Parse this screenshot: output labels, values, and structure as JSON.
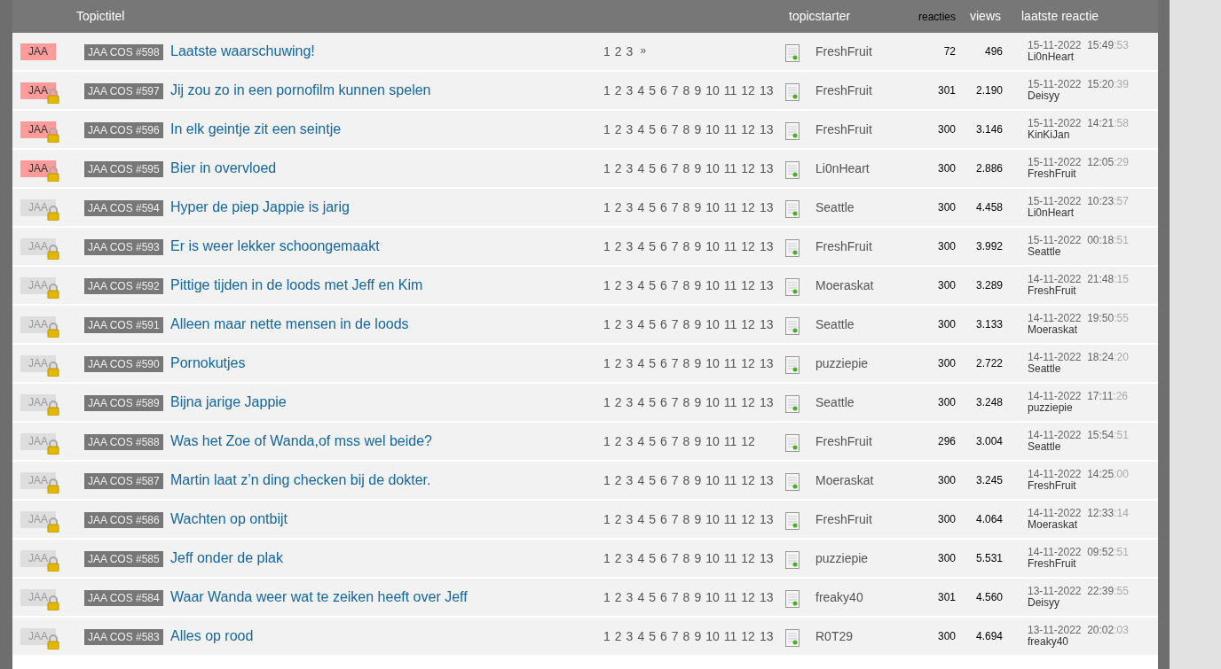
{
  "columns": [
    "Topictitel",
    "topicstarter",
    "reacties",
    "views",
    "laatste reactie"
  ],
  "topics": [
    {
      "label": "JAA",
      "unread": true,
      "locked": false,
      "tag": "JAA COS #598",
      "title": "Laatste waarschuwing!",
      "pages": [
        "1",
        "2",
        "3",
        "»"
      ],
      "starter": "FreshFruit",
      "replies": "72",
      "views": "496",
      "date": "15-11-2022",
      "time": "15:49",
      "seconds": ":53",
      "last_user": "Li0nHeart"
    },
    {
      "label": "JAA",
      "unread": true,
      "locked": true,
      "tag": "JAA COS #597",
      "title": "Jij zou zo in een pornofilm kunnen spelen",
      "pages": [
        "1",
        "2",
        "3",
        "4",
        "5",
        "6",
        "7",
        "8",
        "9",
        "10",
        "11",
        "12",
        "13"
      ],
      "starter": "FreshFruit",
      "replies": "301",
      "views": "2.190",
      "date": "15-11-2022",
      "time": "15:20",
      "seconds": ":39",
      "last_user": "Deisyy"
    },
    {
      "label": "JAA",
      "unread": true,
      "locked": true,
      "tag": "JAA COS #596",
      "title": "In elk geintje zit een seintje",
      "pages": [
        "1",
        "2",
        "3",
        "4",
        "5",
        "6",
        "7",
        "8",
        "9",
        "10",
        "11",
        "12",
        "13"
      ],
      "starter": "FreshFruit",
      "replies": "300",
      "views": "3.146",
      "date": "15-11-2022",
      "time": "14:21",
      "seconds": ":58",
      "last_user": "KinKiJan"
    },
    {
      "label": "JAA",
      "unread": true,
      "locked": true,
      "tag": "JAA COS #595",
      "title": "Bier in overvloed",
      "pages": [
        "1",
        "2",
        "3",
        "4",
        "5",
        "6",
        "7",
        "8",
        "9",
        "10",
        "11",
        "12",
        "13"
      ],
      "starter": "Li0nHeart",
      "replies": "300",
      "views": "2.886",
      "date": "15-11-2022",
      "time": "12:05",
      "seconds": ":29",
      "last_user": "FreshFruit"
    },
    {
      "label": "JAA",
      "unread": false,
      "locked": true,
      "tag": "JAA COS #594",
      "title": "Hyper de piep Jappie is jarig",
      "pages": [
        "1",
        "2",
        "3",
        "4",
        "5",
        "6",
        "7",
        "8",
        "9",
        "10",
        "11",
        "12",
        "13"
      ],
      "starter": "Seattle",
      "replies": "300",
      "views": "4.458",
      "date": "15-11-2022",
      "time": "10:23",
      "seconds": ":57",
      "last_user": "Li0nHeart"
    },
    {
      "label": "JAA",
      "unread": false,
      "locked": true,
      "tag": "JAA COS #593",
      "title": "Er is weer lekker schoongemaakt",
      "pages": [
        "1",
        "2",
        "3",
        "4",
        "5",
        "6",
        "7",
        "8",
        "9",
        "10",
        "11",
        "12",
        "13"
      ],
      "starter": "FreshFruit",
      "replies": "300",
      "views": "3.992",
      "date": "15-11-2022",
      "time": "00:18",
      "seconds": ":51",
      "last_user": "Seattle"
    },
    {
      "label": "JAA",
      "unread": false,
      "locked": true,
      "tag": "JAA COS #592",
      "title": "Pittige tijden in de loods met Jeff en Kim",
      "pages": [
        "1",
        "2",
        "3",
        "4",
        "5",
        "6",
        "7",
        "8",
        "9",
        "10",
        "11",
        "12",
        "13"
      ],
      "starter": "Moeraskat",
      "replies": "300",
      "views": "3.289",
      "date": "14-11-2022",
      "time": "21:48",
      "seconds": ":15",
      "last_user": "FreshFruit"
    },
    {
      "label": "JAA",
      "unread": false,
      "locked": true,
      "tag": "JAA COS #591",
      "title": "Alleen maar nette mensen in de loods",
      "pages": [
        "1",
        "2",
        "3",
        "4",
        "5",
        "6",
        "7",
        "8",
        "9",
        "10",
        "11",
        "12",
        "13"
      ],
      "starter": "Seattle",
      "replies": "300",
      "views": "3.133",
      "date": "14-11-2022",
      "time": "19:50",
      "seconds": ":55",
      "last_user": "Moeraskat"
    },
    {
      "label": "JAA",
      "unread": false,
      "locked": true,
      "tag": "JAA COS #590",
      "title": "Pornokutjes",
      "pages": [
        "1",
        "2",
        "3",
        "4",
        "5",
        "6",
        "7",
        "8",
        "9",
        "10",
        "11",
        "12",
        "13"
      ],
      "starter": "puzziepie",
      "replies": "300",
      "views": "2.722",
      "date": "14-11-2022",
      "time": "18:24",
      "seconds": ":20",
      "last_user": "Seattle"
    },
    {
      "label": "JAA",
      "unread": false,
      "locked": true,
      "tag": "JAA COS #589",
      "title": "Bijna jarige Jappie",
      "pages": [
        "1",
        "2",
        "3",
        "4",
        "5",
        "6",
        "7",
        "8",
        "9",
        "10",
        "11",
        "12",
        "13"
      ],
      "starter": "Seattle",
      "replies": "300",
      "views": "3.248",
      "date": "14-11-2022",
      "time": "17:11",
      "seconds": ":26",
      "last_user": "puzziepie"
    },
    {
      "label": "JAA",
      "unread": false,
      "locked": true,
      "tag": "JAA COS #588",
      "title": "Was het Zoe of Wanda,of mss wel beide?",
      "pages": [
        "1",
        "2",
        "3",
        "4",
        "5",
        "6",
        "7",
        "8",
        "9",
        "10",
        "11",
        "12"
      ],
      "starter": "FreshFruit",
      "replies": "296",
      "views": "3.004",
      "date": "14-11-2022",
      "time": "15:54",
      "seconds": ":51",
      "last_user": "Seattle"
    },
    {
      "label": "JAA",
      "unread": false,
      "locked": true,
      "tag": "JAA COS #587",
      "title": "Martin laat z’n ding checken bij de dokter.",
      "pages": [
        "1",
        "2",
        "3",
        "4",
        "5",
        "6",
        "7",
        "8",
        "9",
        "10",
        "11",
        "12",
        "13"
      ],
      "starter": "Moeraskat",
      "replies": "300",
      "views": "3.245",
      "date": "14-11-2022",
      "time": "14:25",
      "seconds": ":00",
      "last_user": "FreshFruit"
    },
    {
      "label": "JAA",
      "unread": false,
      "locked": true,
      "tag": "JAA COS #586",
      "title": "Wachten op ontbijt",
      "pages": [
        "1",
        "2",
        "3",
        "4",
        "5",
        "6",
        "7",
        "8",
        "9",
        "10",
        "11",
        "12",
        "13"
      ],
      "starter": "FreshFruit",
      "replies": "300",
      "views": "4.064",
      "date": "14-11-2022",
      "time": "12:33",
      "seconds": ":14",
      "last_user": "Moeraskat"
    },
    {
      "label": "JAA",
      "unread": false,
      "locked": true,
      "tag": "JAA COS #585",
      "title": "Jeff onder de plak",
      "pages": [
        "1",
        "2",
        "3",
        "4",
        "5",
        "6",
        "7",
        "8",
        "9",
        "10",
        "11",
        "12",
        "13"
      ],
      "starter": "puzziepie",
      "replies": "300",
      "views": "5.531",
      "date": "14-11-2022",
      "time": "09:52",
      "seconds": ":51",
      "last_user": "FreshFruit"
    },
    {
      "label": "JAA",
      "unread": false,
      "locked": true,
      "tag": "JAA COS #584",
      "title": "Waar Wanda weer wat te zeiken heeft over Jeff",
      "pages": [
        "1",
        "2",
        "3",
        "4",
        "5",
        "6",
        "7",
        "8",
        "9",
        "10",
        "11",
        "12",
        "13"
      ],
      "starter": "freaky40",
      "replies": "301",
      "views": "4.560",
      "date": "13-11-2022",
      "time": "22:39",
      "seconds": ":55",
      "last_user": "Deisyy"
    },
    {
      "label": "JAA",
      "unread": false,
      "locked": true,
      "tag": "JAA COS #583",
      "title": "Alles op rood",
      "pages": [
        "1",
        "2",
        "3",
        "4",
        "5",
        "6",
        "7",
        "8",
        "9",
        "10",
        "11",
        "12",
        "13"
      ],
      "starter": "R0T29",
      "replies": "300",
      "views": "4.694",
      "date": "13-11-2022",
      "time": "20:02",
      "seconds": ":03",
      "last_user": "freaky40"
    }
  ]
}
